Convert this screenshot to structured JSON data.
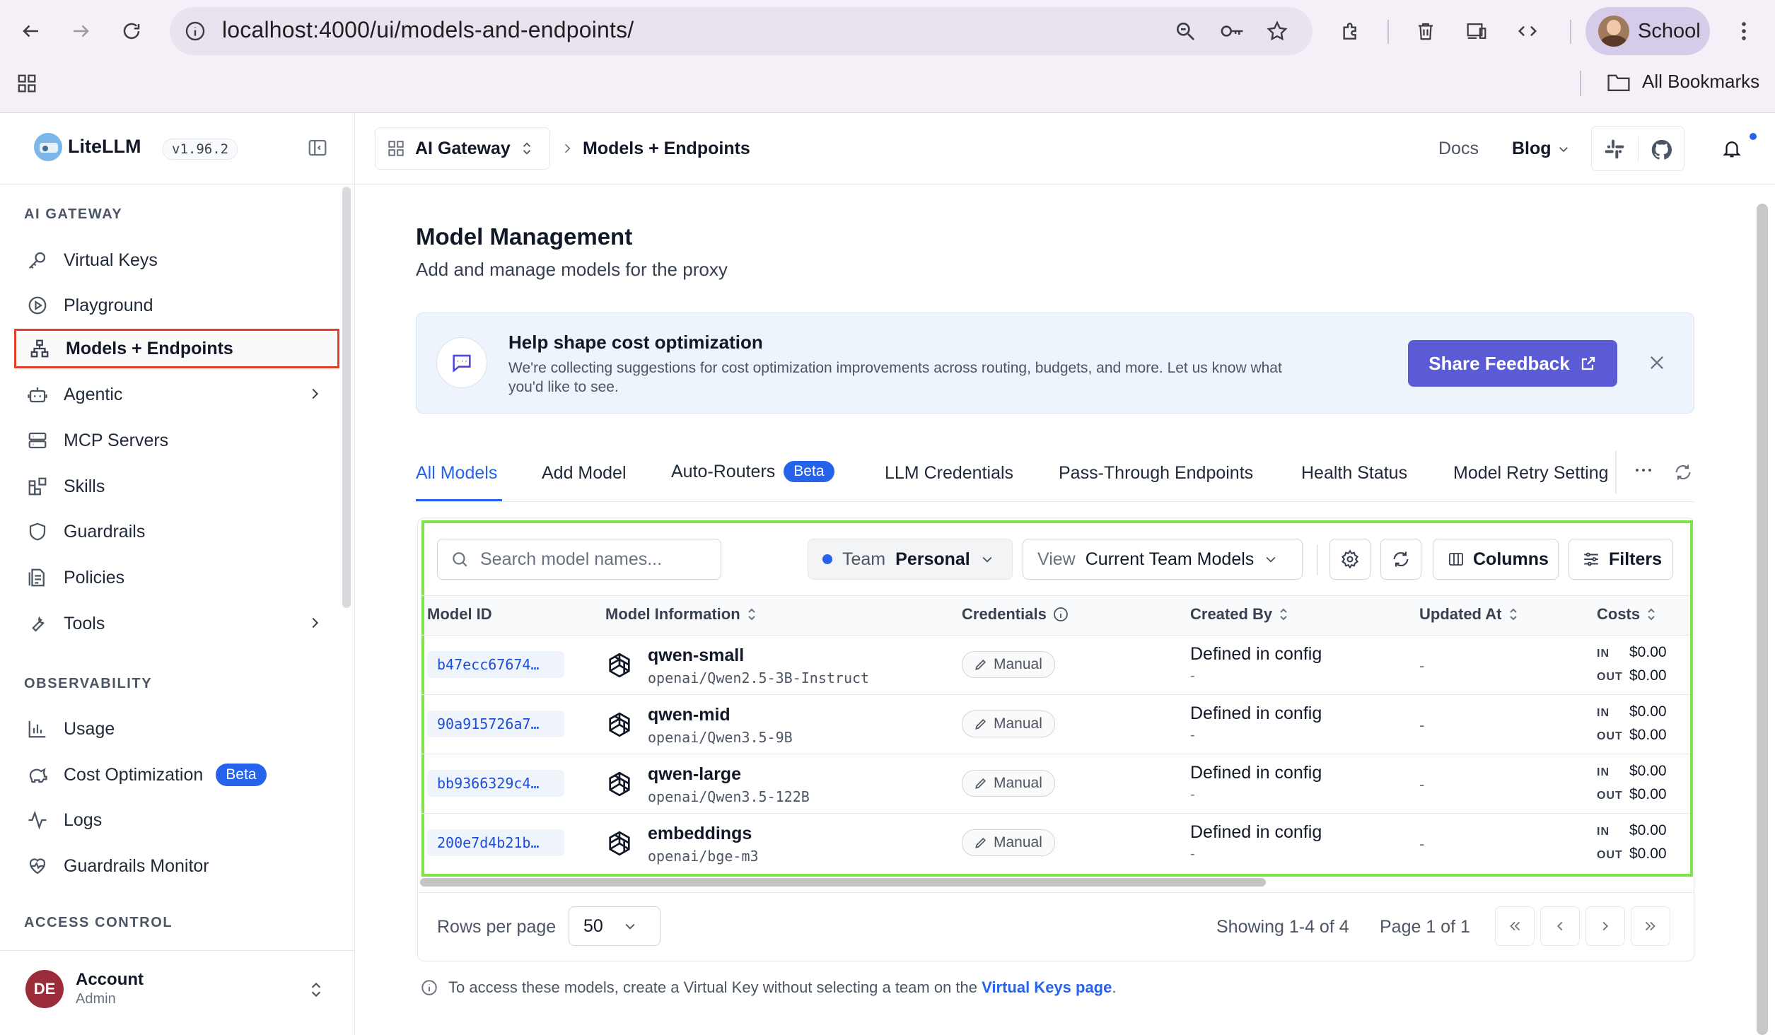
{
  "browser": {
    "url": "localhost:4000/ui/models-and-endpoints/",
    "profile_name": "School",
    "bookmarks_label": "All Bookmarks"
  },
  "sidebar": {
    "brand": "LiteLLM",
    "version": "v1.96.2",
    "sections": {
      "ai_gateway": "AI GATEWAY",
      "observability": "OBSERVABILITY",
      "access_control": "ACCESS CONTROL"
    },
    "items": [
      {
        "label": "Virtual Keys",
        "icon": "key-icon"
      },
      {
        "label": "Playground",
        "icon": "play-circle-icon"
      },
      {
        "label": "Models + Endpoints",
        "icon": "network-icon",
        "active": true
      },
      {
        "label": "Agentic",
        "icon": "robot-icon"
      },
      {
        "label": "MCP Servers",
        "icon": "server-icon"
      },
      {
        "label": "Skills",
        "icon": "blocks-icon"
      },
      {
        "label": "Guardrails",
        "icon": "shield-icon"
      },
      {
        "label": "Policies",
        "icon": "document-icon"
      },
      {
        "label": "Tools",
        "icon": "wrench-icon"
      },
      {
        "label": "Usage",
        "icon": "bar-chart-icon"
      },
      {
        "label": "Cost Optimization",
        "icon": "piggy-bank-icon",
        "badge": "Beta"
      },
      {
        "label": "Logs",
        "icon": "activity-icon"
      },
      {
        "label": "Guardrails Monitor",
        "icon": "heart-pulse-icon"
      }
    ],
    "account": {
      "initials": "DE",
      "name": "Account",
      "role": "Admin"
    }
  },
  "topbar": {
    "workspace": "AI Gateway",
    "page": "Models + Endpoints",
    "docs": "Docs",
    "blog": "Blog"
  },
  "page": {
    "title": "Model Management",
    "subtitle": "Add and manage models for the proxy"
  },
  "banner": {
    "title": "Help shape cost optimization",
    "text_line1": "We're collecting suggestions for cost optimization improvements across routing, budgets, and more. Let us know what",
    "text_line2": "you'd like to see.",
    "button": "Share Feedback"
  },
  "tabs": [
    {
      "label": "All Models",
      "active": true
    },
    {
      "label": "Add Model"
    },
    {
      "label": "Auto-Routers",
      "badge": "Beta"
    },
    {
      "label": "LLM Credentials"
    },
    {
      "label": "Pass-Through Endpoints"
    },
    {
      "label": "Health Status"
    },
    {
      "label": "Model Retry Setting"
    }
  ],
  "toolbar": {
    "search_placeholder": "Search model names...",
    "team_label": "Team",
    "team_value": "Personal",
    "view_label": "View",
    "view_value": "Current Team Models",
    "columns_button": "Columns",
    "filters_button": "Filters"
  },
  "table": {
    "headers": [
      "Model ID",
      "Model Information",
      "Credentials",
      "Created By",
      "Updated At",
      "Costs"
    ],
    "cost_in_label": "IN",
    "cost_out_label": "OUT",
    "rows": [
      {
        "id": "b47ecc67674…",
        "name": "qwen-small",
        "path": "openai/Qwen2.5-3B-Instruct",
        "credential": "Manual",
        "created_by": "Defined in config",
        "created_sub": "-",
        "updated": "-",
        "cost_in": "$0.00",
        "cost_out": "$0.00"
      },
      {
        "id": "90a915726a7…",
        "name": "qwen-mid",
        "path": "openai/Qwen3.5-9B",
        "credential": "Manual",
        "created_by": "Defined in config",
        "created_sub": "-",
        "updated": "-",
        "cost_in": "$0.00",
        "cost_out": "$0.00"
      },
      {
        "id": "bb9366329c4…",
        "name": "qwen-large",
        "path": "openai/Qwen3.5-122B",
        "credential": "Manual",
        "created_by": "Defined in config",
        "created_sub": "-",
        "updated": "-",
        "cost_in": "$0.00",
        "cost_out": "$0.00"
      },
      {
        "id": "200e7d4b21b…",
        "name": "embeddings",
        "path": "openai/bge-m3",
        "credential": "Manual",
        "created_by": "Defined in config",
        "created_sub": "-",
        "updated": "-",
        "cost_in": "$0.00",
        "cost_out": "$0.00"
      }
    ]
  },
  "pagination": {
    "rows_per_page_label": "Rows per page",
    "rows_per_page_value": "50",
    "showing": "Showing 1-4 of 4",
    "page": "Page 1 of 1"
  },
  "footer_note": {
    "text": "To access these models, create a Virtual Key without selecting a team on the",
    "link": "Virtual Keys page",
    "end": "."
  },
  "colors": {
    "accent": "#2563eb",
    "primary_button": "#5b5bd6",
    "highlight_box": "#7fe34a",
    "active_outline": "#e0412c"
  }
}
